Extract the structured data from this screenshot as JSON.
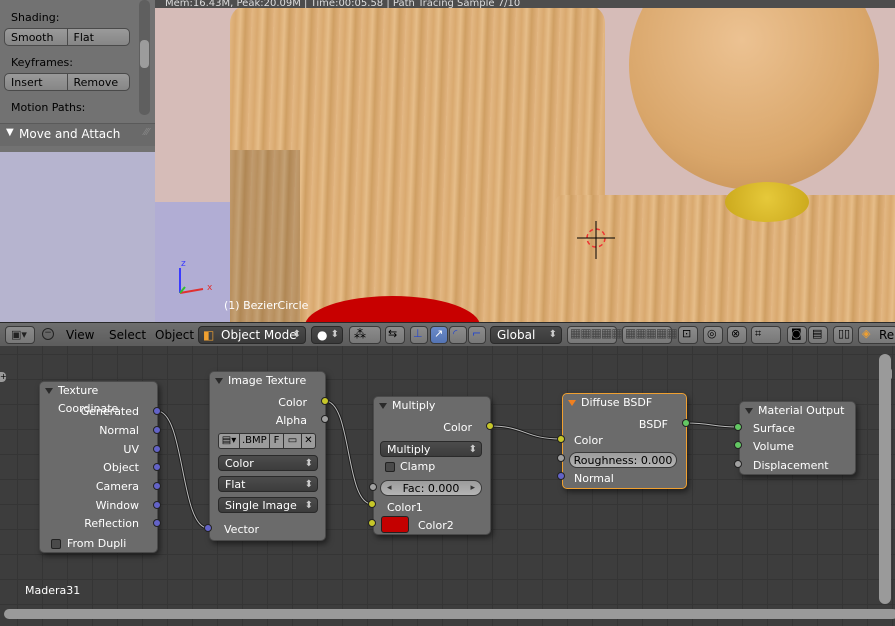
{
  "toolshelf": {
    "shading_label": "Shading:",
    "smooth_label": "Smooth",
    "flat_label": "Flat",
    "keyframes_label": "Keyframes:",
    "insert_label": "Insert",
    "remove_label": "Remove",
    "motion_paths_label": "Motion Paths:",
    "move_attach_label": "Move and Attach"
  },
  "viewport": {
    "status_text": "Mem:16.43M, Peak:20.09M | Time:00:05.58 | Path Tracing Sample 7/10",
    "object_label": "(1) BezierCircle",
    "axis_x": "x",
    "axis_z": "z"
  },
  "header": {
    "view_label": "View",
    "select_label": "Select",
    "object_label": "Object",
    "mode_label": "Object Mode",
    "orientation_label": "Global",
    "render_label": "Re"
  },
  "nodes": {
    "texcoord": {
      "title": "Texture Coordinate",
      "outputs": [
        "Generated",
        "Normal",
        "UV",
        "Object",
        "Camera",
        "Window",
        "Reflection"
      ],
      "from_dupli": "From Dupli"
    },
    "imagetex": {
      "title": "Image Texture",
      "out_color": "Color",
      "out_alpha": "Alpha",
      "image_name": ".BMP",
      "fake_user": "F",
      "color_space": "Color",
      "projection": "Flat",
      "source": "Single Image",
      "in_vector": "Vector"
    },
    "multiply": {
      "title": "Multiply",
      "out_color": "Color",
      "blend_mode": "Multiply",
      "clamp": "Clamp",
      "fac": "Fac: 0.000",
      "color1": "Color1",
      "color2": "Color2",
      "color2_swatch": "#c40000"
    },
    "diffuse": {
      "title": "Diffuse BSDF",
      "out_bsdf": "BSDF",
      "in_color": "Color",
      "roughness": "Roughness: 0.000",
      "in_normal": "Normal"
    },
    "output": {
      "title": "Material Output",
      "surface": "Surface",
      "volume": "Volume",
      "displacement": "Displacement"
    }
  },
  "material_name": "Madera31",
  "colors": {
    "selected_node_border": "#f0a030",
    "socket_shader": "#63c763",
    "socket_color": "#c7c729",
    "socket_vector": "#6363c7",
    "socket_float": "#a1a1a1"
  }
}
